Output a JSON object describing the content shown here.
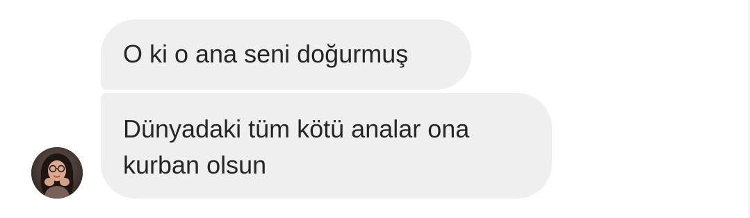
{
  "conversation": {
    "messages": [
      {
        "text": "O ki o ana seni doğurmuş"
      },
      {
        "text": "Dünyadaki tüm kötü analar ona kurban olsun"
      }
    ]
  },
  "sender": {
    "avatar_icon": "profile-photo"
  }
}
